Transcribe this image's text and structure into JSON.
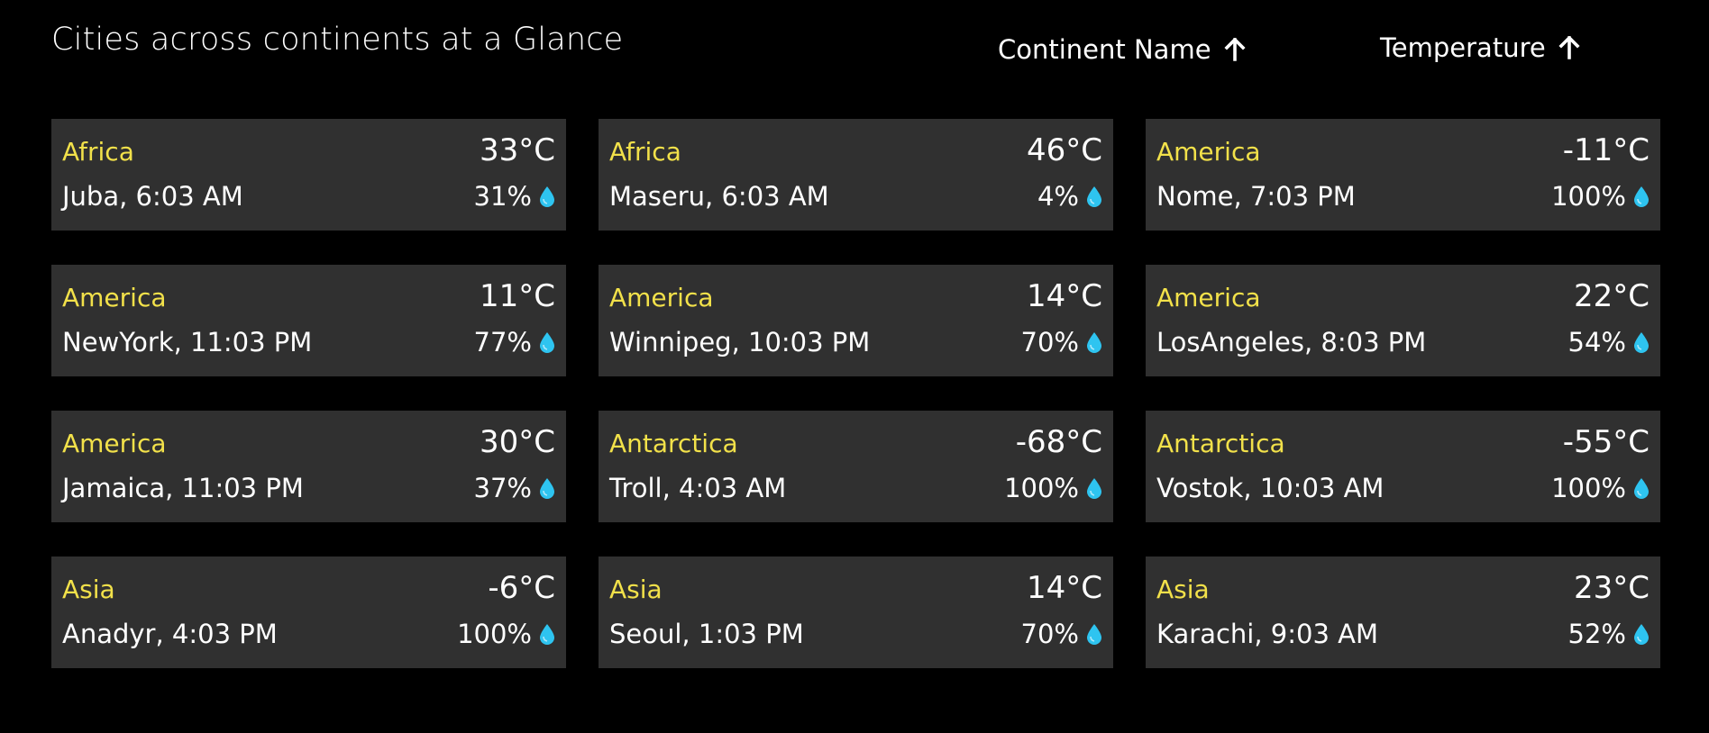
{
  "header": {
    "title": "Cities across continents at a Glance",
    "sort_continent_label": "Continent Name",
    "sort_temperature_label": "Temperature",
    "sort_icon": "arrow-up-icon"
  },
  "colors": {
    "background": "#000000",
    "card": "#303030",
    "continent_text": "#f2e14a",
    "drop_icon": "#2ec4f0"
  },
  "cities": [
    {
      "continent": "Africa",
      "temp": "33°C",
      "city_time": "Juba, 6:03 AM",
      "humidity": "31%"
    },
    {
      "continent": "Africa",
      "temp": "46°C",
      "city_time": "Maseru, 6:03 AM",
      "humidity": "4%"
    },
    {
      "continent": "America",
      "temp": "-11°C",
      "city_time": "Nome, 7:03 PM",
      "humidity": "100%"
    },
    {
      "continent": "America",
      "temp": "11°C",
      "city_time": "NewYork, 11:03 PM",
      "humidity": "77%"
    },
    {
      "continent": "America",
      "temp": "14°C",
      "city_time": "Winnipeg, 10:03 PM",
      "humidity": "70%"
    },
    {
      "continent": "America",
      "temp": "22°C",
      "city_time": "LosAngeles, 8:03 PM",
      "humidity": "54%"
    },
    {
      "continent": "America",
      "temp": "30°C",
      "city_time": "Jamaica, 11:03 PM",
      "humidity": "37%"
    },
    {
      "continent": "Antarctica",
      "temp": "-68°C",
      "city_time": "Troll, 4:03 AM",
      "humidity": "100%"
    },
    {
      "continent": "Antarctica",
      "temp": "-55°C",
      "city_time": "Vostok, 10:03 AM",
      "humidity": "100%"
    },
    {
      "continent": "Asia",
      "temp": "-6°C",
      "city_time": "Anadyr, 4:03 PM",
      "humidity": "100%"
    },
    {
      "continent": "Asia",
      "temp": "14°C",
      "city_time": "Seoul, 1:03 PM",
      "humidity": "70%"
    },
    {
      "continent": "Asia",
      "temp": "23°C",
      "city_time": "Karachi, 9:03 AM",
      "humidity": "52%"
    }
  ]
}
